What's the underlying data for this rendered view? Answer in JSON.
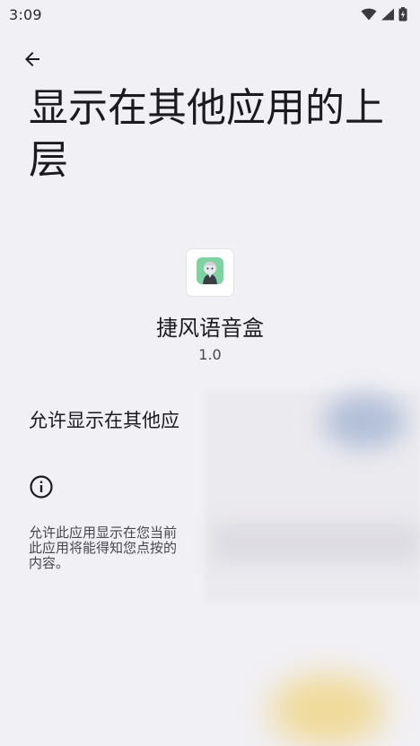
{
  "status_bar": {
    "time": "3:09",
    "icons": [
      "wifi-icon",
      "cell-signal-icon",
      "battery-charging-icon"
    ]
  },
  "header": {
    "back_icon": "arrow-left-icon",
    "title": "显示在其他应用的上层"
  },
  "app": {
    "name": "捷风语音盒",
    "version": "1.0",
    "icon": "app-avatar-icon"
  },
  "permission": {
    "label": "允许显示在其他应"
  },
  "info": {
    "icon": "info-icon",
    "text_line1": "允许此应用显示在您当前",
    "text_line2": "此应用将能得知您点按的",
    "text_line3": "内容。"
  },
  "colors": {
    "background": "#f1f0f5",
    "text_primary": "#1b1b1f",
    "text_secondary": "#46464f"
  }
}
